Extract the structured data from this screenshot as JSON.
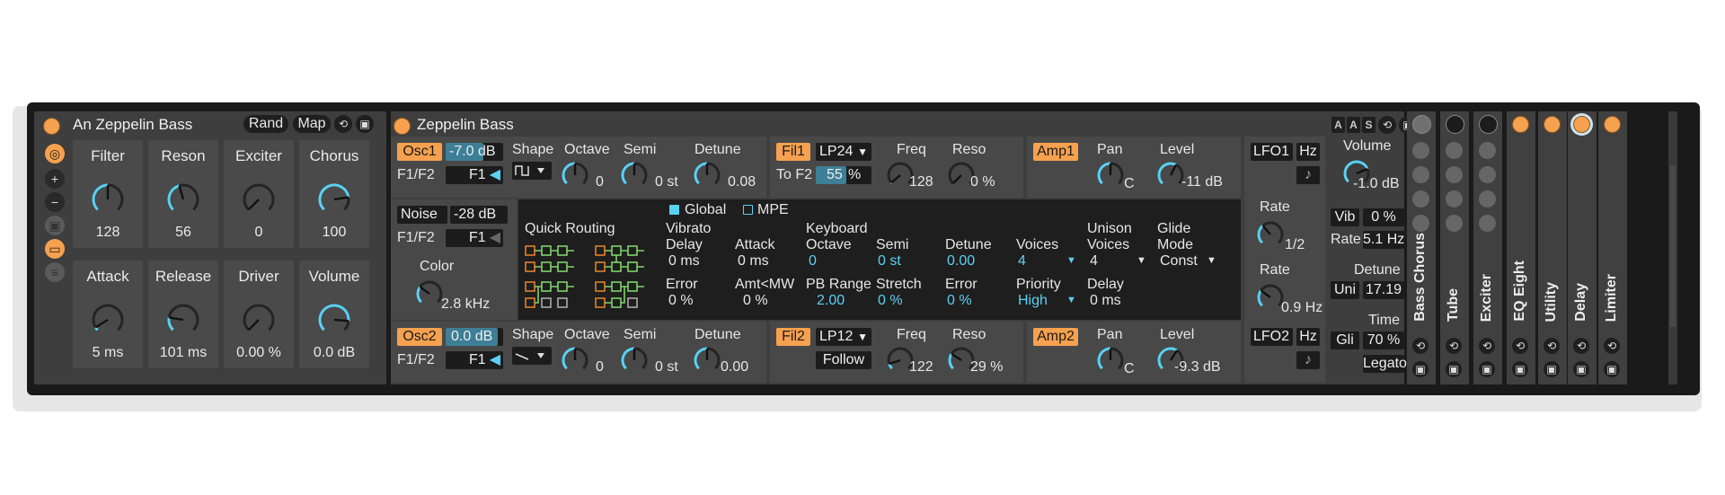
{
  "rack": {
    "title": "An Zeppelin Bass",
    "rand_label": "Rand",
    "map_label": "Map",
    "macros": [
      {
        "name": "Filter",
        "value": "128",
        "level": 0.5
      },
      {
        "name": "Reson",
        "value": "56",
        "level": 0.44
      },
      {
        "name": "Exciter",
        "value": "0",
        "level": 0.0
      },
      {
        "name": "Chorus",
        "value": "100",
        "level": 0.8
      },
      {
        "name": "Attack",
        "value": "5 ms",
        "level": 0.05
      },
      {
        "name": "Release",
        "value": "101 ms",
        "level": 0.2
      },
      {
        "name": "Driver",
        "value": "0.00 %",
        "level": 0.0
      },
      {
        "name": "Volume",
        "value": "0.0 dB",
        "level": 0.85
      }
    ]
  },
  "synth": {
    "title": "Zeppelin Bass",
    "osc1": {
      "label": "Osc1",
      "level": "-7.0 dB",
      "f1f2_label": "F1/F2",
      "f1f2_value": "F1",
      "shape_label": "Shape",
      "octave_label": "Octave",
      "octave_value": "0",
      "semi_label": "Semi",
      "semi_value": "0 st",
      "detune_label": "Detune",
      "detune_value": "0.08"
    },
    "noise": {
      "label": "Noise",
      "level": "-28 dB",
      "f1f2_label": "F1/F2",
      "f1f2_value": "F1",
      "color_label": "Color",
      "color_value": "2.8 kHz"
    },
    "osc2": {
      "label": "Osc2",
      "level": "0.0 dB",
      "f1f2_label": "F1/F2",
      "f1f2_value": "F1",
      "shape_label": "Shape",
      "octave_label": "Octave",
      "octave_value": "0",
      "semi_label": "Semi",
      "semi_value": "0 st",
      "detune_label": "Detune",
      "detune_value": "0.00"
    },
    "fil1": {
      "label": "Fil1",
      "type": "LP24",
      "to_label": "To F2",
      "to_value": "55",
      "to_unit": "%",
      "to_fraction": 0.55,
      "freq_label": "Freq",
      "freq_value": "128",
      "reso_label": "Reso",
      "reso_value": "0 %"
    },
    "fil2": {
      "label": "Fil2",
      "type": "LP12",
      "follow_label": "Follow",
      "freq_label": "Freq",
      "freq_value": "122",
      "reso_label": "Reso",
      "reso_value": "29 %"
    },
    "amp1": {
      "label": "Amp1",
      "pan_label": "Pan",
      "pan_value": "C",
      "level_label": "Level",
      "level_value": "-11 dB"
    },
    "amp2": {
      "label": "Amp2",
      "pan_label": "Pan",
      "pan_value": "C",
      "level_label": "Level",
      "level_value": "-9.3 dB"
    },
    "lfo1": {
      "label": "LFO1",
      "hz_label": "Hz",
      "rate_label": "Rate",
      "rate_value": "1/2"
    },
    "lfo2": {
      "label": "LFO2",
      "hz_label": "Hz",
      "rate_label": "Rate",
      "rate_value": "0.9 Hz"
    },
    "global": {
      "tab_global": "Global",
      "tab_mpe": "MPE",
      "quick_routing_label": "Quick Routing",
      "vibrato_label": "Vibrato",
      "delay_label": "Delay",
      "delay_value": "0 ms",
      "attack_label": "Attack",
      "attack_value": "0 ms",
      "error_label": "Error",
      "error_value": "0 %",
      "amtmw_label": "Amt<MW",
      "amtmw_value": "0 %",
      "keyboard_label": "Keyboard",
      "octave_label": "Octave",
      "octave_value": "0",
      "semi_label": "Semi",
      "semi_value": "0 st",
      "detune_label": "Detune",
      "detune_value": "0.00",
      "voices_label": "Voices",
      "voices_value": "4",
      "pbrange_label": "PB Range",
      "pbrange_value": "2.00",
      "stretch_label": "Stretch",
      "stretch_value": "0 %",
      "kerror_label": "Error",
      "kerror_value": "0 %",
      "priority_label": "Priority",
      "priority_value": "High",
      "unison_label": "Unison",
      "unison_voices_label": "Voices",
      "unison_voices_value": "4",
      "unison_delay_label": "Delay",
      "unison_delay_value": "0 ms",
      "glide_label": "Glide",
      "glide_mode_label": "Mode",
      "glide_mode_value": "Const"
    },
    "output": {
      "volume_label": "Volume",
      "volume_value": "-1.0 dB",
      "vib_label": "Vib",
      "vib_value": "0 %",
      "rate_label": "Rate",
      "rate_value": "5.1 Hz",
      "detune_label": "Detune",
      "uni_label": "Uni",
      "uni_value": "17.19",
      "time_label": "Time",
      "gli_label": "Gli",
      "gli_value": "70 %",
      "legato_label": "Legato"
    },
    "header_icons": [
      "A",
      "A",
      "S"
    ]
  },
  "chain": {
    "devices": [
      "Bass Chorus",
      "Tube",
      "Exciter",
      "EQ Eight",
      "Utility",
      "Delay",
      "Limiter"
    ]
  },
  "colors": {
    "accent": "#f6a14f",
    "value": "#5ad1f4",
    "panel": "#484848",
    "display": "#1e1e1e"
  }
}
